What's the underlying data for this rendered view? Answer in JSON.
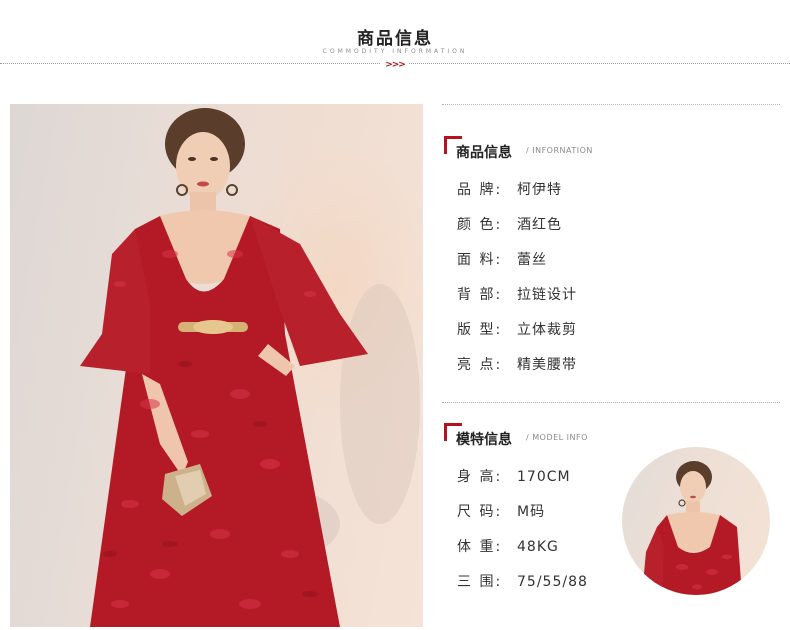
{
  "header": {
    "title": "商品信息",
    "subtitle": "COMMODITY INFORMATION",
    "arrows": ">>>"
  },
  "product_section": {
    "title": "商品信息",
    "tag": "/ INFORNATION",
    "rows": [
      {
        "key": "品  牌:",
        "value": "柯伊特"
      },
      {
        "key": "颜  色:",
        "value": "酒红色"
      },
      {
        "key": "面  料:",
        "value": "蕾丝"
      },
      {
        "key": "背  部:",
        "value": "拉链设计"
      },
      {
        "key": "版  型:",
        "value": "立体裁剪"
      },
      {
        "key": "亮  点:",
        "value": "精美腰带"
      }
    ]
  },
  "model_section": {
    "title": "模特信息",
    "tag": "/ MODEL INFO",
    "rows": [
      {
        "key": "身  高:",
        "value": "170CM"
      },
      {
        "key": "尺  码:",
        "value": "M码"
      },
      {
        "key": "体  重:",
        "value": "48KG"
      },
      {
        "key": "三  围:",
        "value": "75/55/88"
      }
    ]
  },
  "colors": {
    "accent": "#b5121b",
    "dress": "#b31a25",
    "text": "#333333"
  },
  "icons": {
    "bracket": "corner-bracket-icon",
    "arrows": "triple-chevron-icon"
  }
}
